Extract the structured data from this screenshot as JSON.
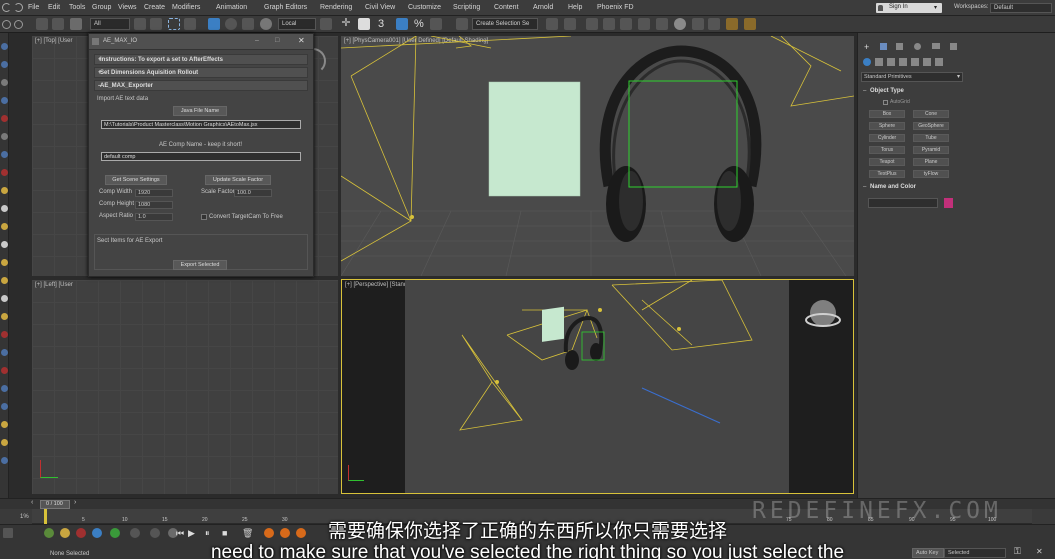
{
  "menubar": {
    "items": [
      "File",
      "Edit",
      "Tools",
      "Group",
      "Views",
      "Create",
      "Modifiers",
      "Animation",
      "Graph Editors",
      "Rendering",
      "Civil View",
      "Customize",
      "Scripting",
      "Content",
      "Arnold",
      "Help",
      "Phoenix FD"
    ],
    "signin": "Sign In",
    "workspace_label": "Workspaces:",
    "workspace_value": "Default"
  },
  "toolbar": {
    "filter_value": "All",
    "coord_value": "Local",
    "selection_set_placeholder": "Create Selection Se",
    "snap_label": "3",
    "angle_label": "%"
  },
  "dialog": {
    "title": "AE_MAX_IO",
    "rollouts": [
      "Instructions: To export a set to AfterEffects",
      "Set Dimensions Aquisition Rollout",
      "AE_MAX_Exporter"
    ],
    "import_label": "Import AE text data",
    "java_button": "Java File Name",
    "path_value": "M:\\Tutorials\\Product Masterclass\\Motion Graphics\\AEtoMax.jsx",
    "comp_name_label": "AE Comp Name - keep it short!",
    "comp_name_value": "default comp",
    "get_scene_button": "Get Scene Settings",
    "update_scale_button": "Update Scale Factor",
    "comp_width_label": "Comp Width",
    "comp_width_value": "1920",
    "comp_height_label": "Comp Height",
    "comp_height_value": "1080",
    "aspect_label": "Aspect Ratio",
    "aspect_value": "1.0",
    "scale_factor_label": "Scale Factor",
    "scale_factor_value": "100.0",
    "convert_label": "Convert TargetCam To Free",
    "select_items_label": "Sect Items for AE Export",
    "export_button": "Export Selected"
  },
  "viewports": {
    "top_label": "[+] [Top] [User",
    "camera_label": "[+] [PhysCamera001] [User Defined] [Default Shading]",
    "left_label": "[+] [Left] [User",
    "perspective_label": "[+] [Perspective] [Standard] [Edged Faces]"
  },
  "command_panel": {
    "dropdown": "Standard Primitives",
    "object_type": "Object Type",
    "autogrid": "AutoGrid",
    "buttons": [
      "Box",
      "Cone",
      "Sphere",
      "GeoSphere",
      "Cylinder",
      "Tube",
      "Torus",
      "Pyramid",
      "Teapot",
      "Plane",
      "TextPlus",
      "tyFlow"
    ],
    "name_color": "Name and Color",
    "swatch_color": "#c2307a"
  },
  "timeline": {
    "frame_display": "0 / 100",
    "ticks": [
      "5",
      "10",
      "15",
      "20",
      "25",
      "30",
      "75",
      "80",
      "85",
      "90",
      "95",
      "100"
    ]
  },
  "statusbar": {
    "zoom": "1%",
    "status_text": "None Selected",
    "autokey": "Auto Key",
    "selected_dropdown": "Selected"
  },
  "subtitles": {
    "cn": "需要确保你选择了正确的东西所以你只需要选择",
    "en": "need to make sure that you've selected the right thing so you just select the"
  },
  "watermark": "REDEFINEFX.COM",
  "colors": {
    "accent": "#3b7fc4",
    "camera_yellow": "#d8c23a",
    "selection_green": "#2fd12f",
    "plane_green": "#c6e8cf"
  }
}
